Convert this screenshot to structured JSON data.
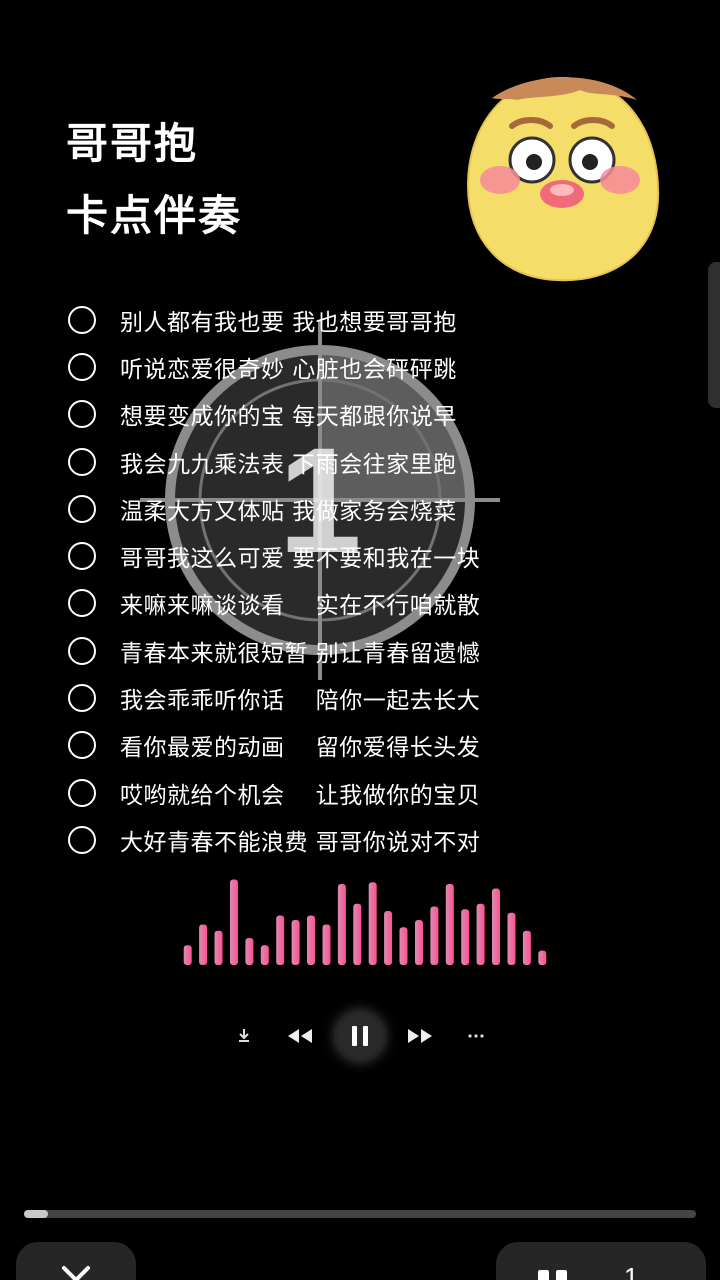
{
  "title": {
    "line1": "哥哥抱",
    "line2": "卡点伴奏"
  },
  "countdown": {
    "number": "1"
  },
  "lyrics": [
    "别人都有我也要 我也想要哥哥抱",
    "听说恋爱很奇妙 心脏也会砰砰跳",
    "想要变成你的宝 每天都跟你说早",
    "我会九九乘法表 下雨会往家里跑",
    "温柔大方又体贴 我做家务会烧菜",
    "哥哥我这么可爱 要不要和我在一块",
    "来嘛来嘛谈谈看    实在不行咱就散",
    "青春本来就很短暂 别让青春留遗憾",
    "我会乖乖听你话    陪你一起去长大",
    "看你最爱的动画    留你爱得长头发",
    "哎哟就给个机会    让我做你的宝贝",
    "大好青春不能浪费 哥哥你说对不对"
  ],
  "player": {
    "controls": [
      "download-icon",
      "rewind-icon",
      "pause-icon",
      "fast-forward-icon",
      "more-icon"
    ],
    "progress_fraction": 0.035
  },
  "visualizer": {
    "bar_levels": [
      0.22,
      0.45,
      0.38,
      0.95,
      0.3,
      0.22,
      0.55,
      0.5,
      0.55,
      0.45,
      0.9,
      0.68,
      0.92,
      0.6,
      0.42,
      0.5,
      0.65,
      0.9,
      0.62,
      0.68,
      0.85,
      0.58,
      0.38,
      0.16
    ]
  },
  "bottom_bar": {
    "page_number": "1"
  },
  "colors": {
    "background": "#000000",
    "visualizer_low": "#d98cb0",
    "visualizer_high": "#ff4f95",
    "mascot_face": "#f5dd6a",
    "mascot_cheek": "#f48a9a"
  }
}
